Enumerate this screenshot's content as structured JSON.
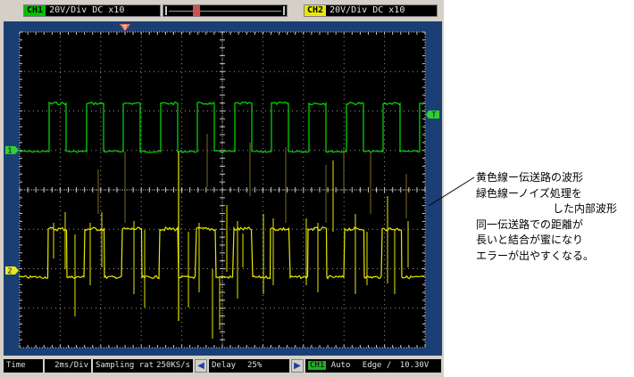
{
  "topbar": {
    "ch1": {
      "tag": "CH1",
      "text": "20V/Div DC x10"
    },
    "ch2": {
      "tag": "CH2",
      "text": "20V/Div DC x10"
    },
    "trigger_position_label": "T"
  },
  "markers": {
    "ch1": "1",
    "ch2": "2",
    "trigger_level": "T"
  },
  "bottombar": {
    "time_label": "Time",
    "time_value": "2ms/Div",
    "sampling_label": "Sampling rate",
    "sampling_value": "250KS/s",
    "delay_label": "Delay",
    "delay_value": "25%",
    "trigger_channel": "CH1",
    "trigger_mode": "Auto",
    "trigger_type": "Edge",
    "trigger_slope": "∕",
    "trigger_level": "10.30V"
  },
  "traces": {
    "ch1_color": "#00e000",
    "ch2_color": "#e8e800",
    "grid_color": "#c8c8c8",
    "screen_color": "#000000",
    "frame_color": "#1b3f74"
  },
  "annotation": {
    "lines": [
      "黄色線ー伝送路の波形",
      "緑色線ーノイズ処理を",
      "した内部波形",
      "同一伝送路での距離が",
      "長いと結合が蜜になり",
      "エラーが出やすくなる。"
    ]
  }
}
